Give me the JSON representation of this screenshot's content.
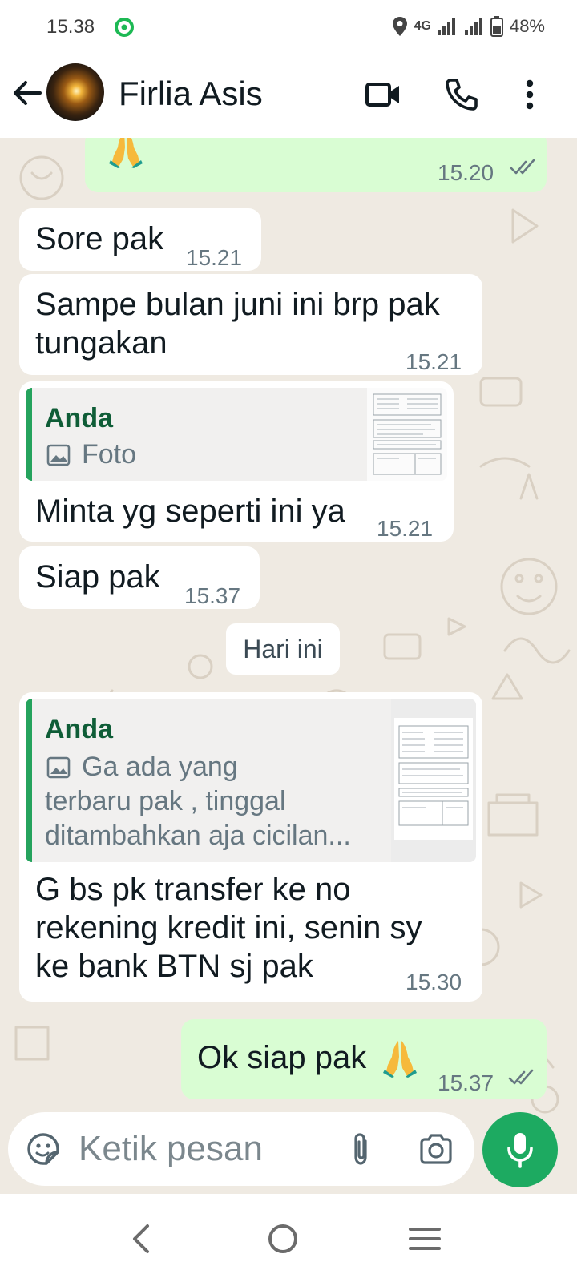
{
  "status_bar": {
    "time": "15.38",
    "network": "4G",
    "battery": "48%"
  },
  "header": {
    "contact_name": "Firlia Asis"
  },
  "messages": [
    {
      "time": "15.20"
    },
    {
      "text": "Sore pak",
      "time": "15.21"
    },
    {
      "line1": "Sampe bulan juni ini brp pak",
      "line2": "tungakan",
      "time": "15.21"
    },
    {
      "quote_author": "Anda",
      "quote_text": "Foto",
      "text": "Minta yg seperti ini ya",
      "time": "15.21"
    },
    {
      "text": "Siap pak",
      "time": "15.37"
    },
    {
      "quote_author": "Anda",
      "quote_line1": "Ga ada yang",
      "quote_line2": "terbaru pak , tinggal",
      "quote_line3": "ditambahkan aja cicilan...",
      "line1": "G bs pk transfer ke no",
      "line2": "rekening kredit ini, senin sy",
      "line3": "ke bank BTN sj pak",
      "time": "15.30"
    },
    {
      "text": "Ok siap pak",
      "time": "15.37"
    }
  ],
  "date_divider": "Hari ini",
  "composer": {
    "placeholder": "Ketik pesan"
  },
  "colors": {
    "accent": "#1daa61",
    "bubble_out": "#d9fdd3",
    "bubble_in": "#ffffff",
    "chat_bg": "#efeae2",
    "quote_bar": "#25a35d",
    "read_ticks": "#667781"
  }
}
